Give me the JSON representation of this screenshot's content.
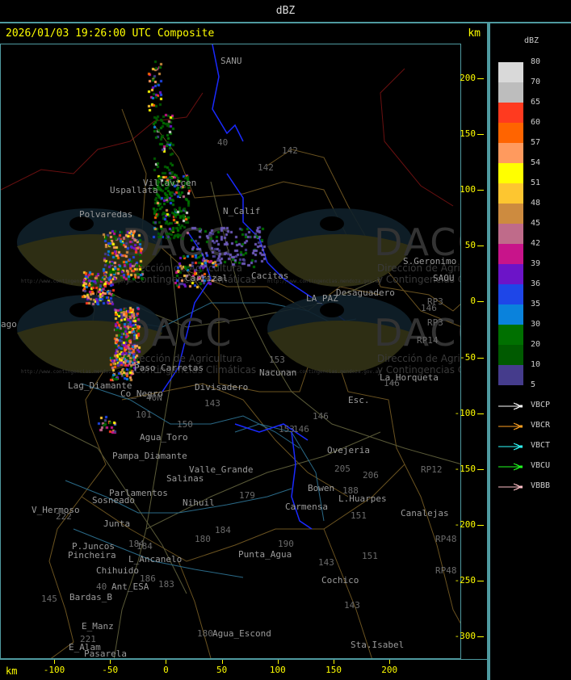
{
  "header": {
    "title": "dBZ"
  },
  "subheader": {
    "timestamp": "2026/01/03 19:26:00 UTC Composite",
    "unit": "km"
  },
  "axes": {
    "y_unit": "km",
    "x_unit": "km",
    "y_ticks": [
      "200",
      "150",
      "100",
      "50",
      "0",
      "-50",
      "-100",
      "-150",
      "-200",
      "-250",
      "-300"
    ],
    "x_ticks": [
      "-100",
      "-50",
      "0",
      "50",
      "100",
      "150",
      "200"
    ]
  },
  "legend": {
    "title": "dBZ",
    "levels": [
      {
        "label": "80",
        "color": "#d9d9d9"
      },
      {
        "label": "70",
        "color": "#bdbdbd"
      },
      {
        "label": "65",
        "color": "#ff3a1f"
      },
      {
        "label": "60",
        "color": "#ff6400"
      },
      {
        "label": "57",
        "color": "#ff9a5e"
      },
      {
        "label": "54",
        "color": "#ffff00"
      },
      {
        "label": "51",
        "color": "#fdc630"
      },
      {
        "label": "48",
        "color": "#cd8b3f"
      },
      {
        "label": "45",
        "color": "#bf6b8a"
      },
      {
        "label": "42",
        "color": "#c8148a"
      },
      {
        "label": "39",
        "color": "#6c14c8"
      },
      {
        "label": "36",
        "color": "#1e46e8"
      },
      {
        "label": "35",
        "color": "#0a82dc"
      },
      {
        "label": "30",
        "color": "#007000"
      },
      {
        "label": "20",
        "color": "#005a00"
      },
      {
        "label": "10",
        "color": "#453c8c"
      },
      {
        "label": "5",
        "color": ""
      }
    ],
    "radars": [
      {
        "label": "VBCP",
        "color": "#ffffff"
      },
      {
        "label": "VBCR",
        "color": "#ffa020"
      },
      {
        "label": "VBCT",
        "color": "#30ffff"
      },
      {
        "label": "VBCU",
        "color": "#20ff20"
      },
      {
        "label": "VBBB",
        "color": "#ffc0c8"
      }
    ]
  },
  "map": {
    "places": [
      "SANU",
      "Villavicen",
      "Uspallata",
      "Polvaredas",
      "N_Calif",
      "S.Geronimo",
      "SAOU",
      "Desaguadero",
      "LA_PAZ",
      "Carrizal",
      "Cacitas",
      "ago",
      "Paso_Carretas",
      "Lag_Diamante",
      "Co_Negro",
      "Divisadero",
      "Nacunan",
      "La_Horqueta",
      "Esc.",
      "Agua_Toro",
      "Pampa_Diamante",
      "Valle_Grande",
      "Ovejeria",
      "Salinas",
      "Parlamentos",
      "Sosneado",
      "Nihuil",
      "Carmensa",
      "L.Huarpes",
      "Canalejas",
      "V_Hermoso",
      "Junta",
      "P.Juncos",
      "Pincheira",
      "L_Ancanelo",
      "Chihuido",
      "Ant_ESA",
      "Punta_Agua",
      "Cochico",
      "Bardas_B",
      "E_Manz",
      "E_Alam",
      "Pasarela",
      "Agua_Escond",
      "Sta.Isabel",
      "Bowen"
    ],
    "routes": [
      "40",
      "142",
      "142",
      "153",
      "143",
      "146",
      "40N",
      "101",
      "150",
      "153",
      "146",
      "205",
      "206",
      "188",
      "151",
      "184",
      "179",
      "180",
      "184",
      "190",
      "151",
      "143",
      "143",
      "180",
      "186",
      "183",
      "145",
      "221",
      "222",
      "184",
      "40",
      "RP3",
      "RP3",
      "RP14",
      "RP12",
      "RP48",
      "RP48",
      "146",
      "146"
    ],
    "watermark": {
      "logo": "DACC",
      "line1": "Dirección de Agricultura",
      "line2": "y Contingencias Climáticas",
      "url": "http://www.contingencias.mendoza.gov.ar"
    }
  }
}
